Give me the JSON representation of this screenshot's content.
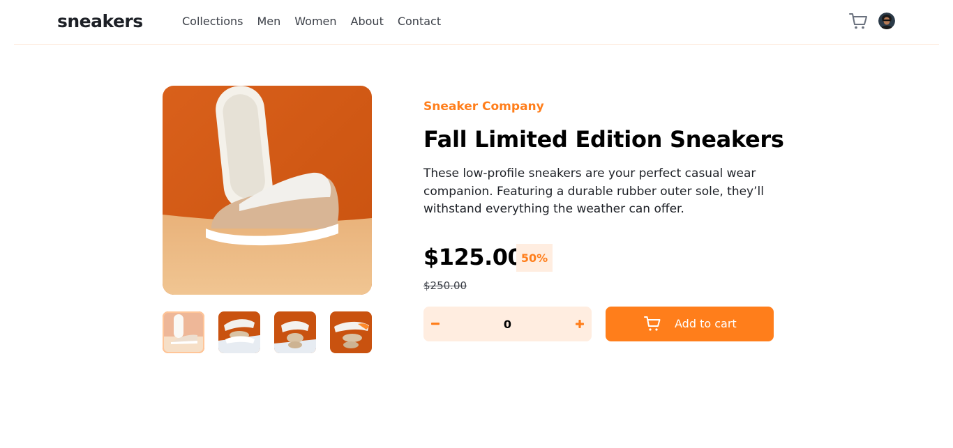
{
  "header": {
    "logo": "sneakers",
    "nav": [
      "Collections",
      "Men",
      "Women",
      "About",
      "Contact"
    ],
    "cart_icon": "cart-icon",
    "avatar_icon": "user-avatar"
  },
  "gallery": {
    "main_alt": "Fall Limited Edition Sneakers product image",
    "thumbnails": [
      "product-1",
      "product-2",
      "product-3",
      "product-4"
    ],
    "active_thumbnail": 0
  },
  "product": {
    "company": "Sneaker Company",
    "title": "Fall Limited Edition Sneakers",
    "description": "These low-profile sneakers are your perfect casual wear companion. Featuring a durable rubber outer sole, they’ll withstand everything the weather can offer.",
    "price": "$125.00",
    "discount": "50%",
    "original_price": "$250.00"
  },
  "quantity": {
    "value": "0",
    "minus_icon": "minus-icon",
    "plus_icon": "plus-icon"
  },
  "cart_button": {
    "label": "Add to cart",
    "icon": "cart-icon"
  },
  "colors": {
    "accent": "#ff7e1b",
    "accent_pale": "#ffede0",
    "text_dark": "#1d2026",
    "text_muted": "#3b3f47"
  }
}
